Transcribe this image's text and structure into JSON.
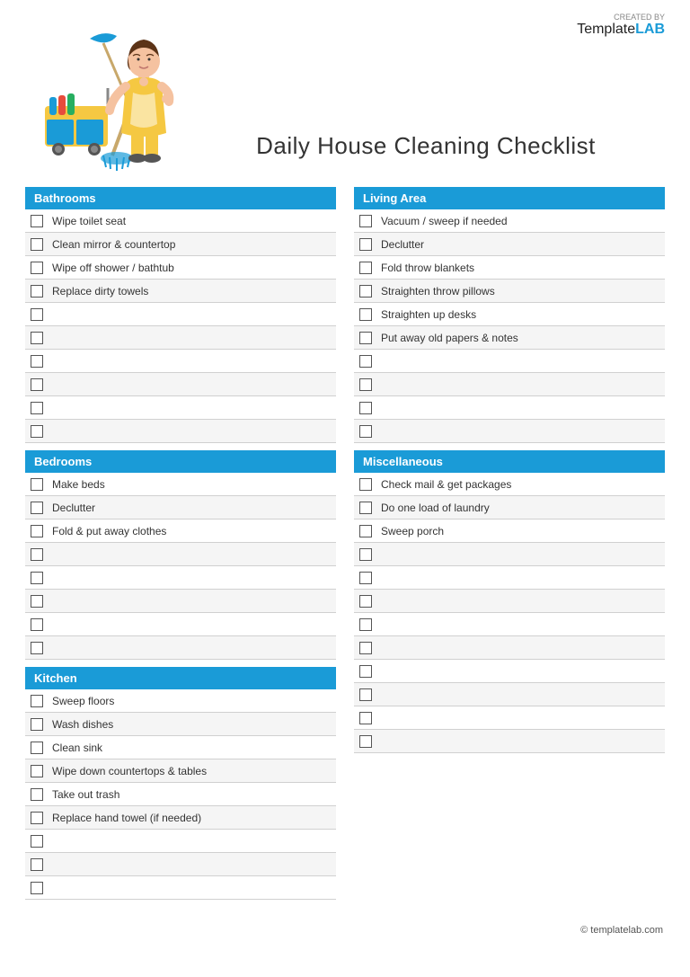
{
  "logo": {
    "created_by": "CREATED BY",
    "brand_template": "Template",
    "brand_lab": "LAB"
  },
  "title": "Daily House Cleaning Checklist",
  "sections": {
    "bathrooms": {
      "label": "Bathrooms",
      "items": [
        "Wipe toilet seat",
        "Clean mirror & countertop",
        "Wipe off shower / bathtub",
        "Replace dirty towels",
        "",
        "",
        "",
        "",
        "",
        ""
      ]
    },
    "bedrooms": {
      "label": "Bedrooms",
      "items": [
        "Make beds",
        "Declutter",
        "Fold & put away clothes",
        "",
        "",
        "",
        "",
        ""
      ]
    },
    "kitchen": {
      "label": "Kitchen",
      "items": [
        "Sweep floors",
        "Wash dishes",
        "Clean sink",
        "Wipe down countertops & tables",
        "Take out trash",
        "Replace hand towel (if needed)",
        "",
        "",
        ""
      ]
    },
    "living_area": {
      "label": "Living Area",
      "items": [
        "Vacuum / sweep if needed",
        "Declutter",
        "Fold throw blankets",
        "Straighten throw pillows",
        "Straighten up desks",
        "Put away old papers & notes",
        "",
        "",
        "",
        ""
      ]
    },
    "miscellaneous": {
      "label": "Miscellaneous",
      "items": [
        "Check mail & get packages",
        "Do one load of laundry",
        "Sweep porch",
        "",
        "",
        "",
        "",
        "",
        "",
        "",
        "",
        ""
      ]
    }
  },
  "footer": "© templatelab.com"
}
